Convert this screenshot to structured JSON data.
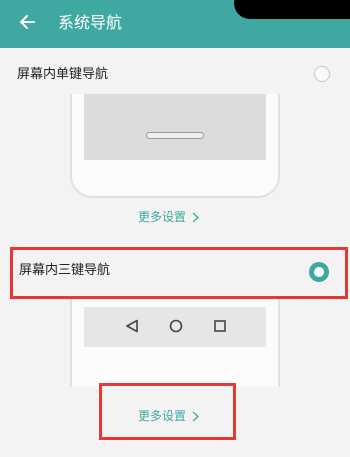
{
  "header": {
    "title": "系统导航",
    "bg_color": "#3fa8a0"
  },
  "options": [
    {
      "label": "屏幕内单键导航",
      "selected": false,
      "more_settings": "更多设置",
      "nav_style": "single-key"
    },
    {
      "label": "屏幕内三键导航",
      "selected": true,
      "more_settings": "更多设置",
      "nav_style": "three-key",
      "keys": [
        "back-triangle-icon",
        "home-circle-icon",
        "recents-square-icon"
      ]
    }
  ],
  "annotations": {
    "highlight_color": "#e53935"
  }
}
